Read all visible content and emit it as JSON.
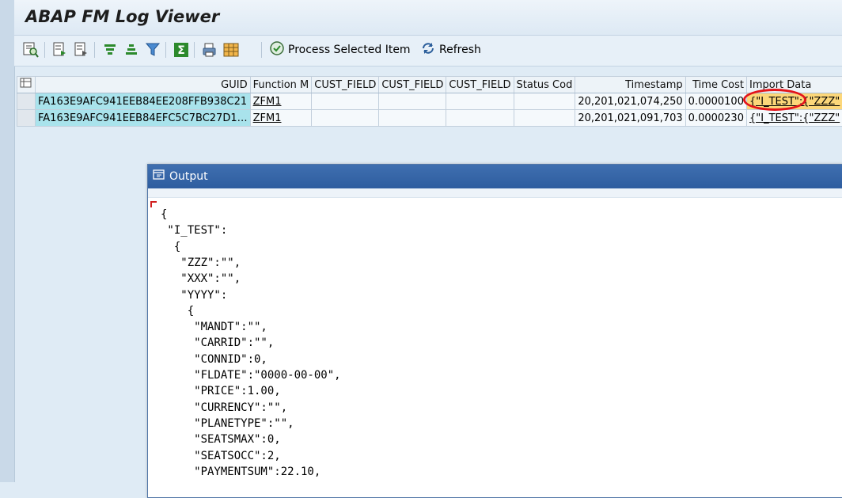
{
  "app": {
    "title": "ABAP FM Log Viewer"
  },
  "toolbar": {
    "process_label": "Process Selected Item",
    "refresh_label": "Refresh"
  },
  "grid": {
    "columns": [
      "GUID",
      "Function M",
      "CUST_FIELD",
      "CUST_FIELD",
      "CUST_FIELD",
      "Status Cod",
      "Timestamp",
      "Time Cost",
      "Import Data"
    ],
    "rows": [
      {
        "guid": "FA163E9AFC941EEB84EE208FFB938C21",
        "function": "ZFM1",
        "cust1": "",
        "cust2": "",
        "cust3": "",
        "status": "",
        "timestamp": "20,201,021,074,250",
        "time_cost": "0.0000100",
        "import_data": "{\"I_TEST\":{\"ZZZ\""
      },
      {
        "guid": "FA163E9AFC941EEB84EFC5C7BC27D1…",
        "function": "ZFM1",
        "cust1": "",
        "cust2": "",
        "cust3": "",
        "status": "",
        "timestamp": "20,201,021,091,703",
        "time_cost": "0.0000230",
        "import_data": "{\"I_TEST\":{\"ZZZ\""
      }
    ]
  },
  "output": {
    "title": "Output",
    "lines": [
      "{",
      " \"I_TEST\":",
      "  {",
      "   \"ZZZ\":\"\",",
      "   \"XXX\":\"\",",
      "   \"YYYY\":",
      "    {",
      "     \"MANDT\":\"\",",
      "     \"CARRID\":\"\",",
      "     \"CONNID\":0,",
      "     \"FLDATE\":\"0000-00-00\",",
      "     \"PRICE\":1.00,",
      "     \"CURRENCY\":\"\",",
      "     \"PLANETYPE\":\"\",",
      "     \"SEATSMAX\":0,",
      "     \"SEATSOCC\":2,",
      "     \"PAYMENTSUM\":22.10,"
    ]
  },
  "colors": {
    "guid_highlight": "#a9e3ec",
    "import_highlight": "#fcd77a",
    "annotation_circle": "#e3141a",
    "dialog_header": "#3f6fb0"
  }
}
